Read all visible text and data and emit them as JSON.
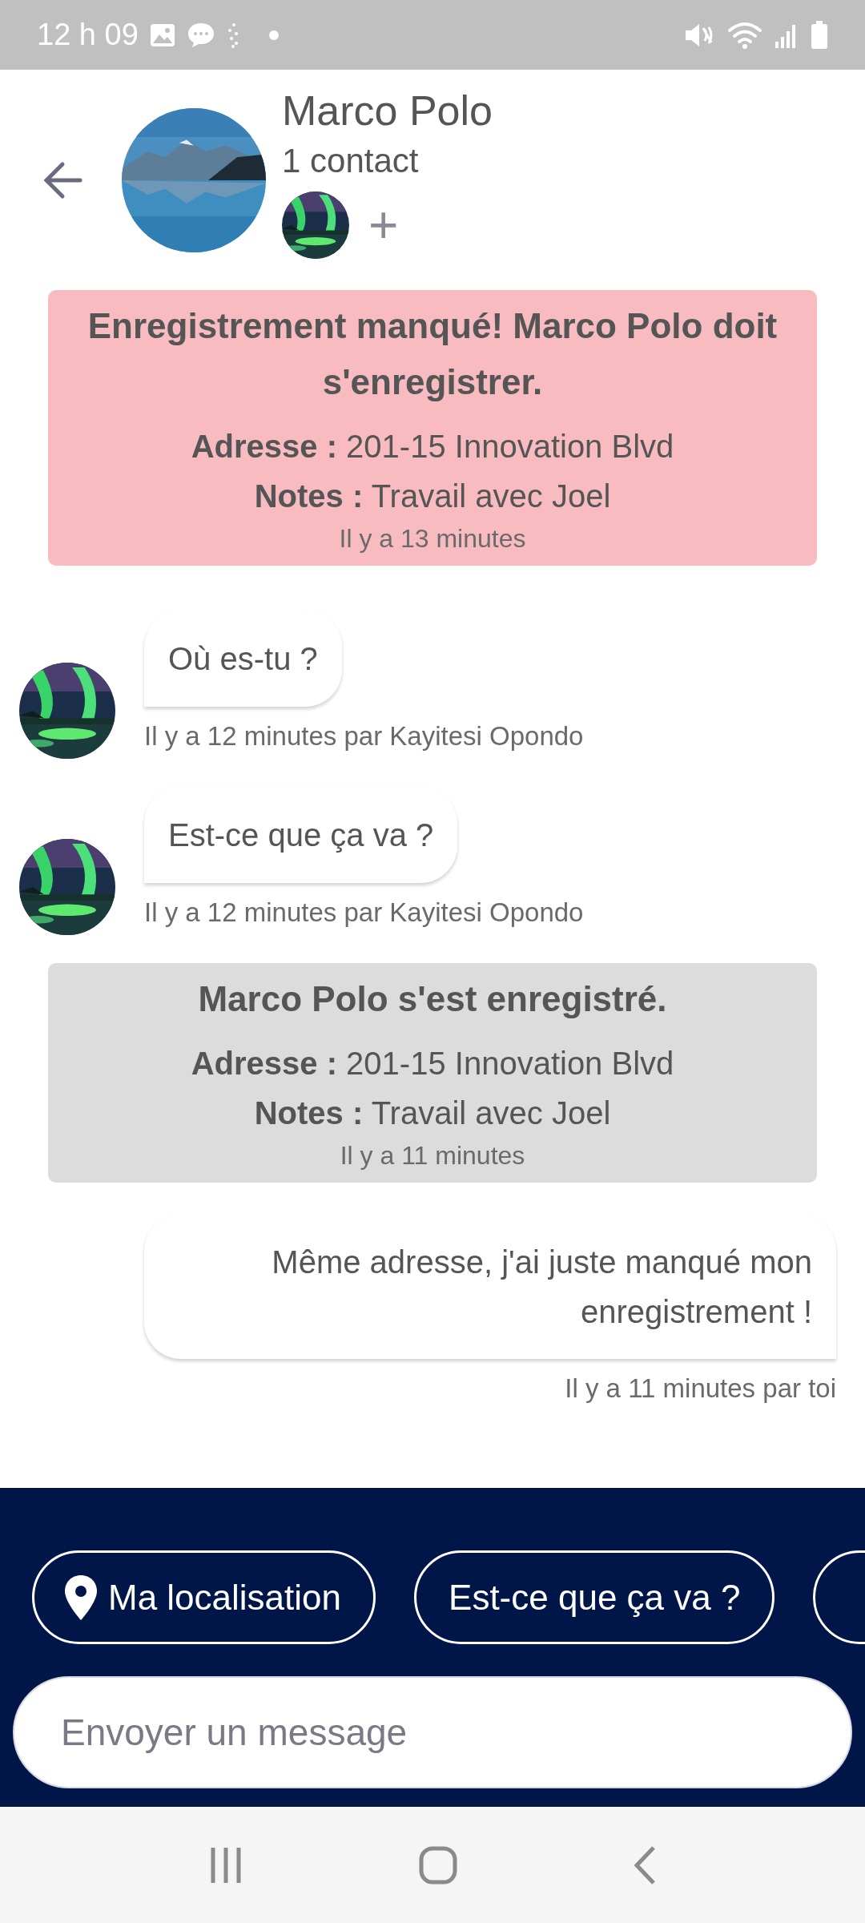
{
  "status_bar": {
    "time": "12 h 09"
  },
  "header": {
    "title": "Marco Polo",
    "subtitle": "1 contact",
    "add_label": "+"
  },
  "feed": [
    {
      "kind": "missed_event",
      "title": "Enregistrement manqué! Marco Polo doit s'enregistrer.",
      "address": "**Adresse :** 201-15 Innovation Blvd",
      "notes": "**Notes :** Travail avec Joel",
      "time": "Il y a 13 minutes"
    },
    {
      "kind": "incoming",
      "text": "Où es-tu ?",
      "meta": "Il y a 12 minutes par Kayitesi Opondo"
    },
    {
      "kind": "incoming",
      "text": "Est-ce que ça va ?",
      "meta": "Il y a 12 minutes par Kayitesi Opondo"
    },
    {
      "kind": "checkin_event",
      "title": "Marco Polo s'est enregistré.",
      "address": "**Adresse :** 201-15 Innovation Blvd",
      "notes": "**Notes :** Travail avec Joel",
      "time": "Il y a 11 minutes"
    },
    {
      "kind": "outgoing",
      "text": "Même adresse, j'ai juste manqué mon enregistrement !",
      "meta": "Il y a 11 minutes par toi"
    }
  ],
  "quick_replies": [
    {
      "kind": "location",
      "label": "Ma localisation"
    },
    {
      "kind": "text",
      "label": "Est-ce que ça va ?"
    }
  ],
  "composer": {
    "placeholder": "Envoyer un message"
  }
}
